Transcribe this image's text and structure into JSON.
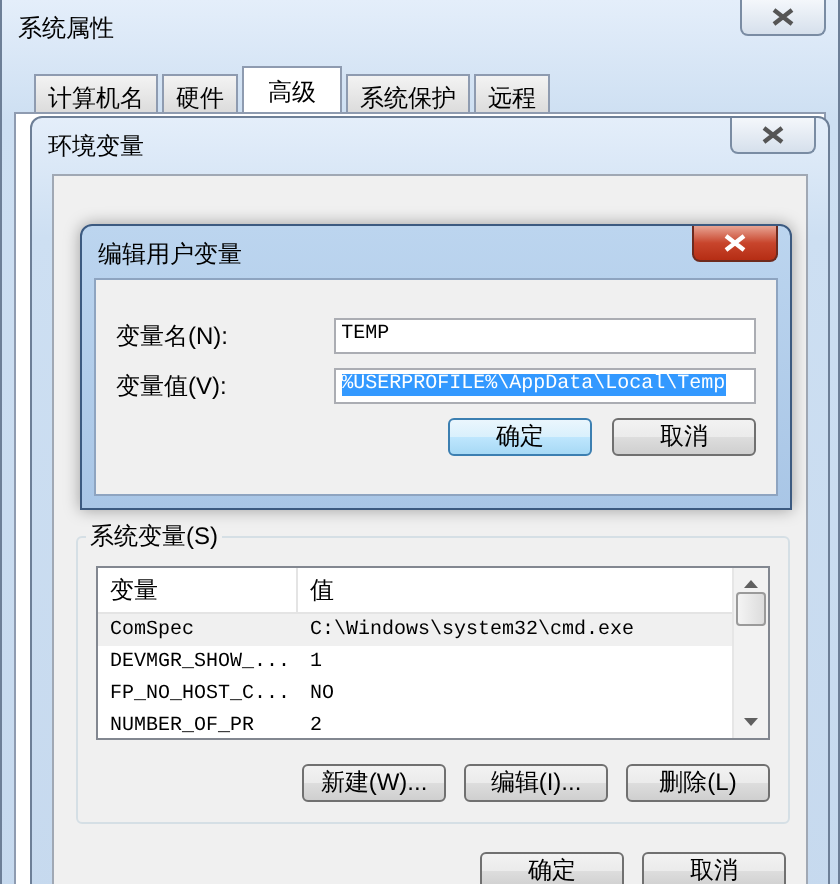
{
  "system_properties": {
    "title": "系统属性",
    "tabs": [
      {
        "label": "计算机名",
        "selected": false
      },
      {
        "label": "硬件",
        "selected": false
      },
      {
        "label": "高级",
        "selected": true
      },
      {
        "label": "系统保护",
        "selected": false
      },
      {
        "label": "远程",
        "selected": false
      }
    ]
  },
  "environment_variables": {
    "title": "环境变量",
    "system_variables": {
      "label": "系统变量(S)",
      "columns": [
        "变量",
        "值"
      ],
      "rows": [
        {
          "name": "ComSpec",
          "value": "C:\\Windows\\system32\\cmd.exe",
          "selected": true
        },
        {
          "name": "DEVMGR_SHOW_...",
          "value": "1",
          "selected": false
        },
        {
          "name": "FP_NO_HOST_C...",
          "value": "NO",
          "selected": false
        },
        {
          "name": "NUMBER_OF_PR",
          "value": "2",
          "selected": false
        }
      ],
      "buttons": [
        "新建(W)...",
        "编辑(I)...",
        "删除(L)"
      ]
    },
    "buttons": [
      "确定",
      "取消"
    ]
  },
  "edit_user_variable": {
    "title": "编辑用户变量",
    "fields": [
      {
        "label": "变量名(N):",
        "value": "TEMP",
        "selected": false
      },
      {
        "label": "变量值(V):",
        "value": "%USERPROFILE%\\AppData\\Local\\Temp",
        "selected": true
      }
    ],
    "buttons": [
      {
        "label": "确定",
        "default": true
      },
      {
        "label": "取消",
        "default": false
      }
    ]
  }
}
